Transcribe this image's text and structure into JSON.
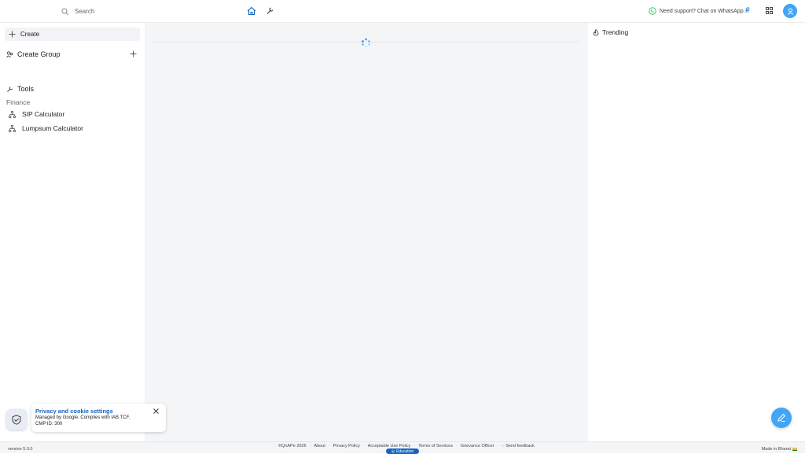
{
  "header": {
    "search_placeholder": "Search",
    "support_text": "Need support? Chat on WhatsApp.",
    "hash_symbol": "#"
  },
  "sidebar": {
    "create_label": "Create",
    "create_group_label": "Create Group",
    "tools_label": "Tools",
    "section_label": "Finance",
    "items": [
      {
        "label": "SIP Calculator"
      },
      {
        "label": "Lumpsum Calculator"
      }
    ]
  },
  "right_panel": {
    "trending_label": "Trending"
  },
  "privacy": {
    "title": "Privacy and cookie settings",
    "subtitle": "Managed by Google. Complies with IAB TCF.",
    "cmp_id": "CMP ID: 300"
  },
  "footer": {
    "version": "version 5.0.0",
    "copyright": "©QnAPe 2026",
    "links": [
      "About",
      "Privacy Policy",
      "Acceptable Use Policy",
      "Terms of Services",
      "Grievance Officer"
    ],
    "feedback": "Send feedback",
    "badge": "Education",
    "made_in": "Made in Bharat"
  },
  "colors": {
    "accent": "#42a5f5",
    "link_blue": "#1565c0",
    "main_bg": "#f4f5f7",
    "whatsapp": "#25d366"
  }
}
